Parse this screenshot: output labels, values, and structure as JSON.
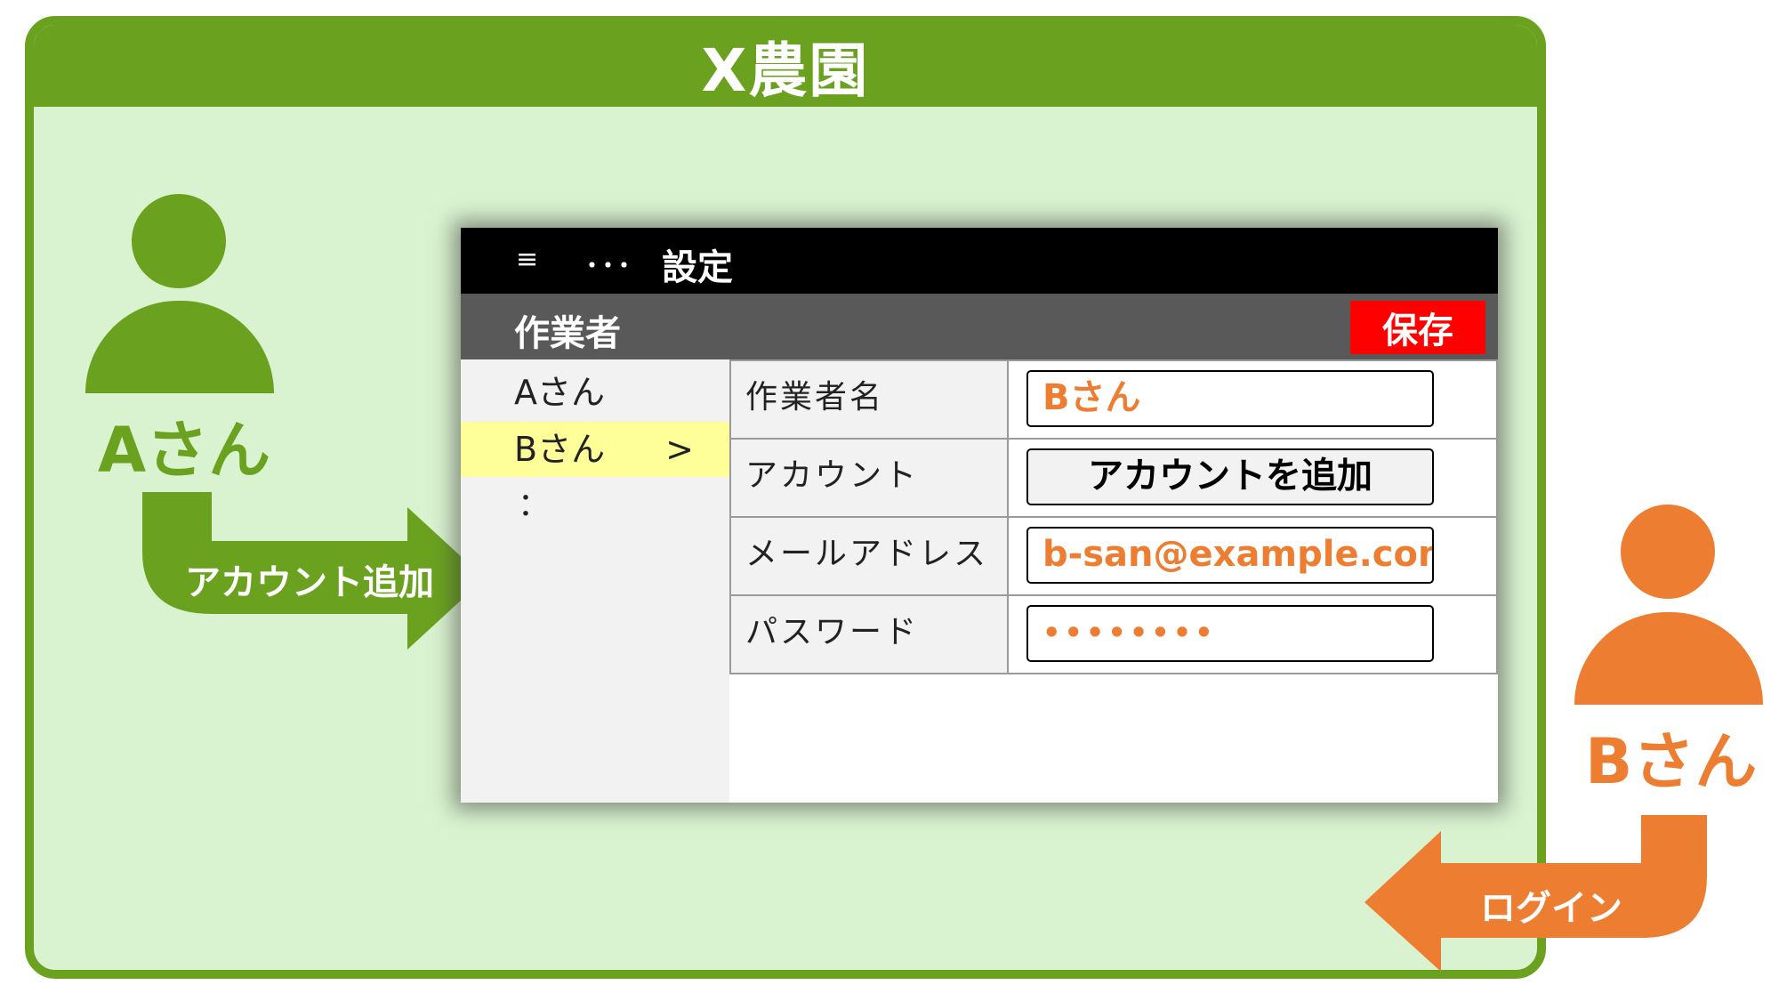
{
  "farm": {
    "title": "X農園"
  },
  "colors": {
    "farm_green": "#6aa220",
    "farm_bg": "#d9f2cf",
    "user_b_orange": "#ed7d31",
    "save_red": "#ff0000",
    "selected_yellow": "#ffff99"
  },
  "people": {
    "a": {
      "name": "Aさん"
    },
    "b": {
      "name": "Bさん"
    }
  },
  "arrows": {
    "add_account": "アカウント追加",
    "login": "ログイン"
  },
  "app": {
    "topbar": {
      "menu_icon": "≡",
      "more_icon": "･･･",
      "title": "設定"
    },
    "subbar": {
      "title": "作業者",
      "save_label": "保存"
    },
    "list": {
      "items": [
        {
          "label": "Aさん"
        },
        {
          "label": "Bさん",
          "chevron": ">"
        }
      ],
      "more": "："
    },
    "form": {
      "rows": [
        {
          "label": "作業者名",
          "value": "Bさん"
        },
        {
          "label": "アカウント",
          "button": "アカウントを追加"
        },
        {
          "label": "メールアドレス",
          "value": "b-san@example.com"
        },
        {
          "label": "パスワード",
          "value": "••••••••"
        }
      ]
    }
  }
}
